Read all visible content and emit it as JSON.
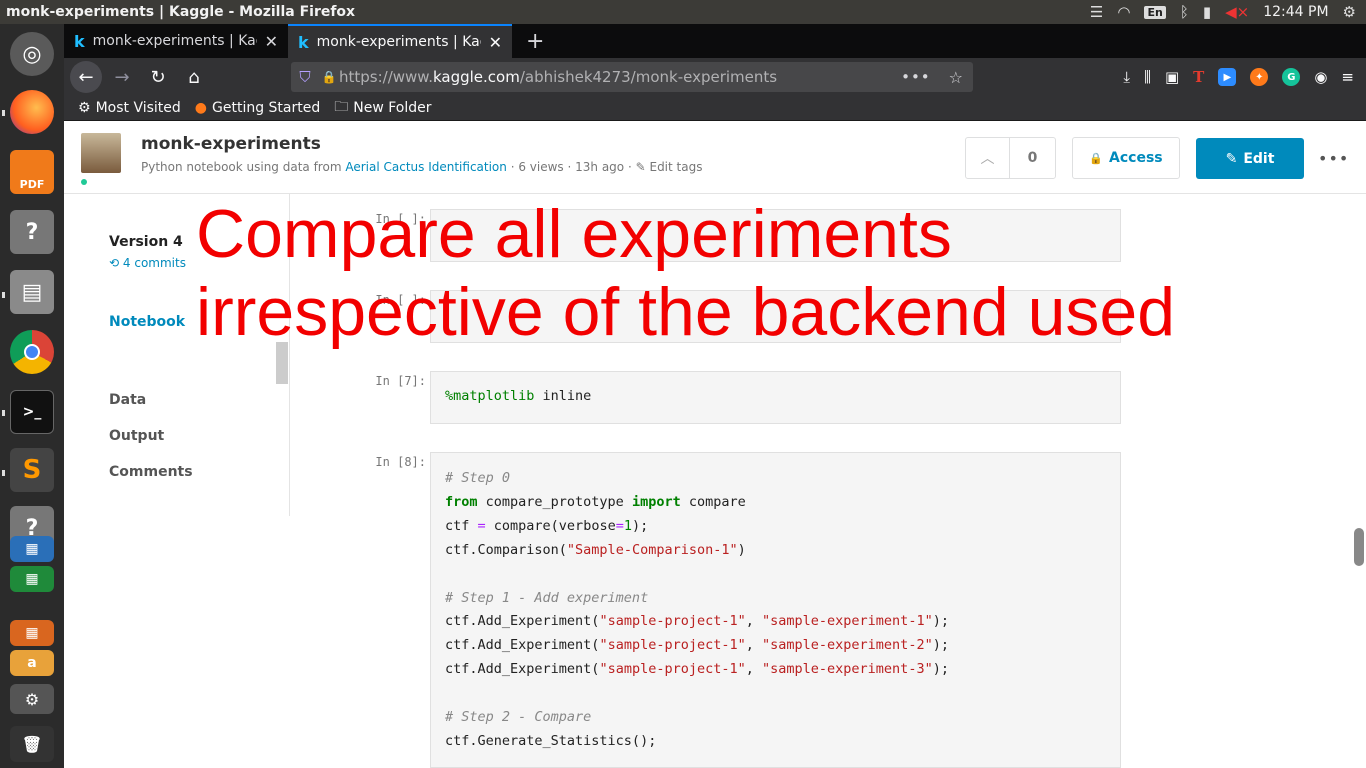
{
  "system": {
    "window_title": "monk-experiments | Kaggle - Mozilla Firefox",
    "lang": "En",
    "time": "12:44 PM"
  },
  "launcher": {
    "items": [
      "ubuntu-dash",
      "firefox",
      "foxit-pdf",
      "unknown-app",
      "file-manager",
      "chrome",
      "terminal",
      "sublime-text",
      "unknown-app-2",
      "libreoffice-impress",
      "libreoffice-calc"
    ],
    "pdf_label": "PDF"
  },
  "browser": {
    "tabs": [
      {
        "label": "monk-experiments | Kag"
      },
      {
        "label": "monk-experiments | Kag"
      }
    ],
    "url_prefix": "https://www.",
    "url_domain": "kaggle.com",
    "url_path": "/abhishek4273/monk-experiments",
    "bookmarks": [
      {
        "label": "Most Visited"
      },
      {
        "label": "Getting Started"
      },
      {
        "label": "New Folder"
      }
    ]
  },
  "kernel": {
    "title": "monk-experiments",
    "meta_prefix": "Python notebook using data from",
    "dataset": "Aerial Cactus Identification",
    "meta_suffix": "· 6 views · 13h ago ·",
    "edit_tags": "Edit tags",
    "votes": "0",
    "access_label": "Access",
    "edit_label": "Edit"
  },
  "sidenav": {
    "version": "Version 4",
    "commits": "4 commits",
    "items": [
      {
        "label": "Notebook"
      },
      {
        "label": "Data"
      },
      {
        "label": "Output"
      },
      {
        "label": "Comments"
      }
    ]
  },
  "cells": {
    "c1_prompt": "In [ ]:",
    "c2_prompt": "In [ ]:",
    "c7_prompt": "In [7]:",
    "c8_prompt": "In [8]:"
  },
  "overlay": {
    "line1": "Compare all experiments",
    "line2": "irrespective of the backend used"
  },
  "colors": {
    "kaggle_blue": "#008abc",
    "overlay_red": "#f20000",
    "firefox_accent": "#0a84ff"
  }
}
